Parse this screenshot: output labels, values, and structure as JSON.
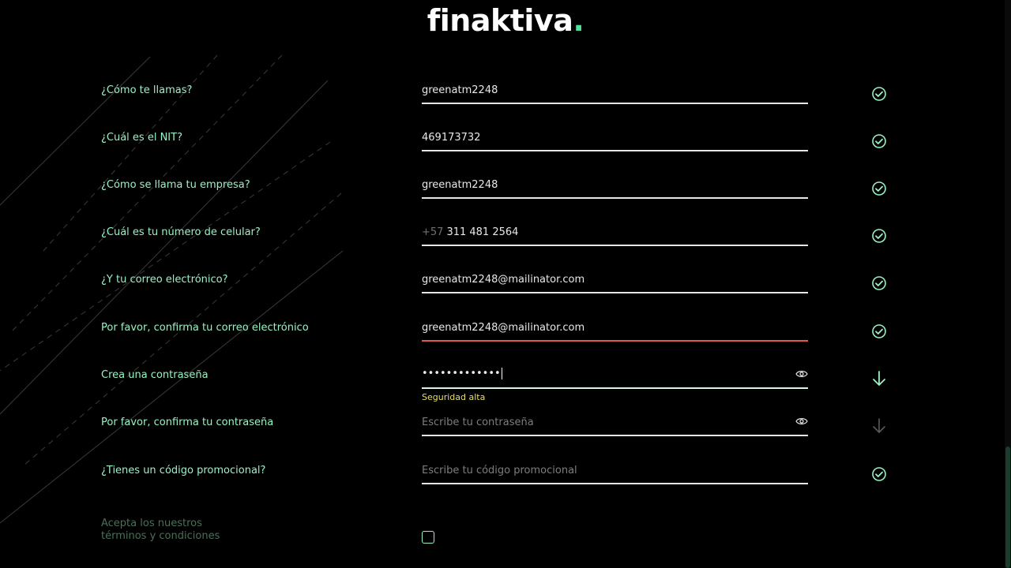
{
  "brand": {
    "logo_text": "finaktiva",
    "logo_dot": ".",
    "accent_color": "#4ee19b"
  },
  "form": {
    "fields": [
      {
        "label": "¿Cómo te llamas?",
        "value": "greenatm2248",
        "status": "check-circle-icon"
      },
      {
        "label": "¿Cuál es el NIT?",
        "value": "469173732",
        "status": "check-circle-icon"
      },
      {
        "label": "¿Cómo se llama tu empresa?",
        "value": "greenatm2248",
        "status": "check-circle-icon"
      },
      {
        "label": "¿Cuál es tu número de celular?",
        "prefix": "+57",
        "value": "311 481 2564",
        "status": "check-circle-icon"
      },
      {
        "label": "¿Y tu correo electrónico?",
        "value": "greenatm2248@mailinator.com",
        "status": "check-circle-icon"
      },
      {
        "label": "Por favor, confirma tu correo electrónico",
        "value": "greenatm2248@mailinator.com",
        "status": "check-circle-icon",
        "underline_color": "#e05a4f"
      },
      {
        "label": "Crea una contraseña",
        "value": "•••••••••••••",
        "strength": "Seguridad alta",
        "status": "arrow-down-icon"
      },
      {
        "label": "Por favor, confirma tu contraseña",
        "placeholder": "Escribe tu contraseña",
        "status": "arrow-down-icon"
      },
      {
        "label": "¿Tienes un código promocional?",
        "placeholder": "Escribe tu código promocional",
        "status": "check-circle-icon"
      }
    ],
    "terms": {
      "line1": "Acepta los nuestros",
      "line2": "términos y condiciones",
      "checked": false
    }
  },
  "colors": {
    "label": "#9af2c3",
    "check": "#9af2c3",
    "strength": "#e8df6b",
    "error_underline": "#e05a4f"
  }
}
